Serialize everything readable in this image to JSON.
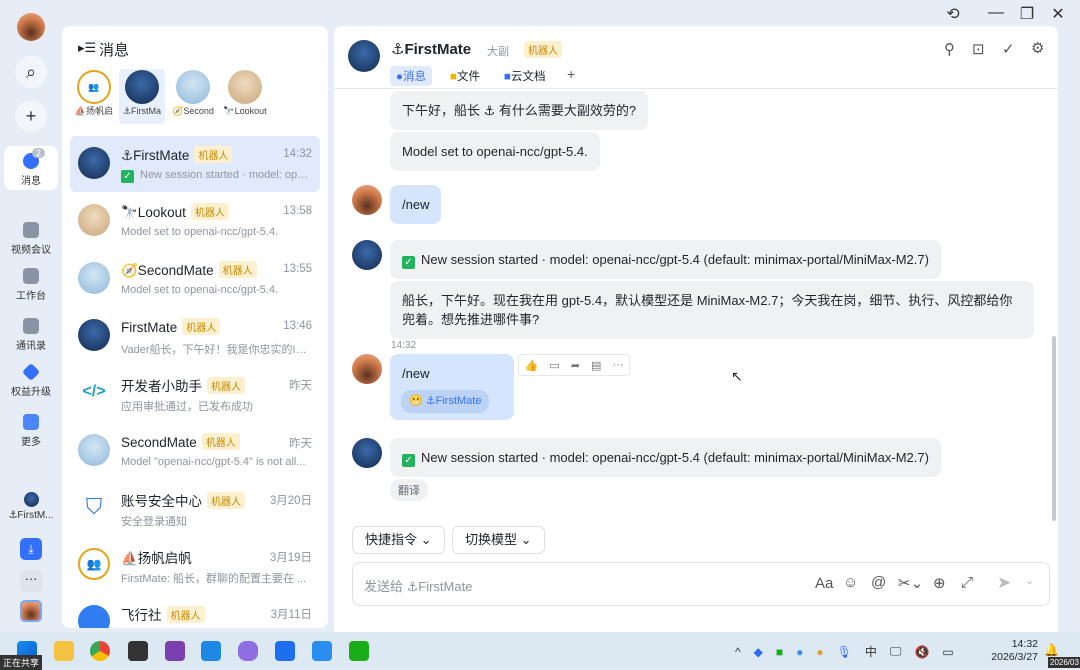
{
  "window": {
    "history_icon": "history-icon",
    "minimize": "—",
    "maximize": "❐",
    "close": "✕"
  },
  "rail": {
    "items": [
      {
        "label": "消息",
        "badge": "2",
        "active": true
      },
      {
        "label": "视频会议"
      },
      {
        "label": "工作台"
      },
      {
        "label": "通讯录"
      },
      {
        "label": "权益升级"
      },
      {
        "label": "更多"
      }
    ],
    "pinned_label": "⚓FirstM..."
  },
  "list": {
    "title": "消息",
    "pins": [
      {
        "label": "⛵扬帆启"
      },
      {
        "label": "⚓FirstMa"
      },
      {
        "label": "🧭Second"
      },
      {
        "label": "🔭Lookout"
      }
    ],
    "bot_tag": "机器人",
    "conversations": [
      {
        "name": "⚓FirstMate",
        "time": "14:32",
        "preview": "New session started · model: ope...",
        "check": true,
        "active": true
      },
      {
        "name": "🔭Lookout",
        "time": "13:58",
        "preview": "Model set to openai-ncc/gpt-5.4."
      },
      {
        "name": "🧭SecondMate",
        "time": "13:55",
        "preview": "Model set to openai-ncc/gpt-5.4."
      },
      {
        "name": "FirstMate",
        "time": "13:46",
        "preview": "Vader船长，下午好！我是你忠实的IS..."
      },
      {
        "name": "开发者小助手",
        "time": "昨天",
        "preview": "应用审批通过，已发布成功"
      },
      {
        "name": "SecondMate",
        "time": "昨天",
        "preview": "Model \"openai-ncc/gpt-5.4\" is not all..."
      },
      {
        "name": "账号安全中心",
        "time": "3月20日",
        "preview": "安全登录通知"
      },
      {
        "name": "⛵扬帆启帆",
        "time": "3月19日",
        "preview": "FirstMate: 船长，群聊的配置主要在 ...",
        "notag": true
      },
      {
        "name": "飞行社",
        "time": "3月11日",
        "preview": ""
      }
    ]
  },
  "chat": {
    "title": "⚓FirstMate",
    "subtitle": "大副",
    "tag": "机器人",
    "tabs": [
      "消息",
      "文件",
      "云文档",
      "+"
    ],
    "messages": [
      {
        "text": "下午好，船长 ⚓ 有什么需要大副效劳的?"
      },
      {
        "text": "Model set to openai-ncc/gpt-5.4."
      },
      {
        "text": "/new"
      },
      {
        "text": "New session started · model: openai-ncc/gpt-5.4 (default: minimax-portal/MiniMax-M2.7)"
      },
      {
        "text": "船长，下午好。现在我在用 gpt-5.4，默认模型还是 MiniMax-M2.7；今天我在岗，细节、执行、风控都给你兜着。想先推进哪件事?"
      },
      {
        "time": "14:32",
        "text": "/new",
        "mention": "⚓FirstMate"
      },
      {
        "text": "New session started · model: openai-ncc/gpt-5.4 (default: minimax-portal/MiniMax-M2.7)",
        "translate": "翻译"
      }
    ],
    "quick_cmd": "快捷指令",
    "switch_model": "切换模型",
    "input_placeholder": "发送给 ⚓FirstMate"
  },
  "taskbar": {
    "time": "14:32",
    "date": "2026/3/27",
    "ime": "中",
    "sharing": "正在共享",
    "tooltip": "2026/03"
  }
}
